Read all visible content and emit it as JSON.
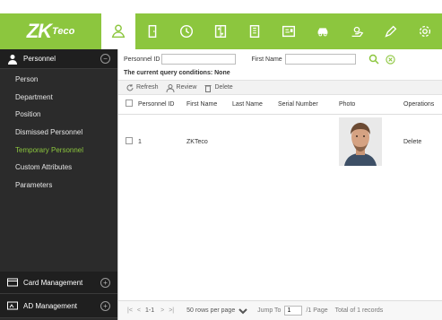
{
  "app": {
    "brand_main": "ZK",
    "brand_sub": "Teco",
    "accent_color": "#8cc63e"
  },
  "topnav": [
    {
      "name": "personnel-icon",
      "active": true
    },
    {
      "name": "door-icon"
    },
    {
      "name": "clock-icon"
    },
    {
      "name": "elevator-icon"
    },
    {
      "name": "building-icon"
    },
    {
      "name": "id-card-icon"
    },
    {
      "name": "car-icon"
    },
    {
      "name": "hand-icon"
    },
    {
      "name": "pen-icon"
    },
    {
      "name": "gear-icon"
    }
  ],
  "sidebar": {
    "group_label": "Personnel",
    "items": [
      {
        "label": "Person"
      },
      {
        "label": "Department"
      },
      {
        "label": "Position"
      },
      {
        "label": "Dismissed Personnel"
      },
      {
        "label": "Temporary Personnel",
        "active": true
      },
      {
        "label": "Custom Attributes"
      },
      {
        "label": "Parameters"
      }
    ],
    "bottom_groups": [
      {
        "label": "Card Management"
      },
      {
        "label": "AD Management"
      }
    ]
  },
  "search": {
    "personnel_id_label": "Personnel ID",
    "personnel_id_value": "",
    "first_name_label": "First Name",
    "first_name_value": ""
  },
  "query_conditions": "The current query conditions: None",
  "toolbar": {
    "refresh": "Refresh",
    "review": "Review",
    "delete": "Delete"
  },
  "table": {
    "columns": [
      "Personnel ID",
      "First Name",
      "Last Name",
      "Serial Number",
      "Photo",
      "Operations"
    ],
    "rows": [
      {
        "personnel_id": "1",
        "first_name": "ZKTeco",
        "last_name": "",
        "serial_number": "",
        "operation": "Delete"
      }
    ]
  },
  "pager": {
    "first": "|<",
    "prev": "<",
    "range": "1-1",
    "next": ">",
    ">|": ">|",
    "last": ">|",
    "rows_per_page": "50 rows per page",
    "jump_to_label": "Jump To",
    "jump_to_value": "1",
    "page_total": "/1 Page",
    "total_records": "Total of 1 records"
  }
}
